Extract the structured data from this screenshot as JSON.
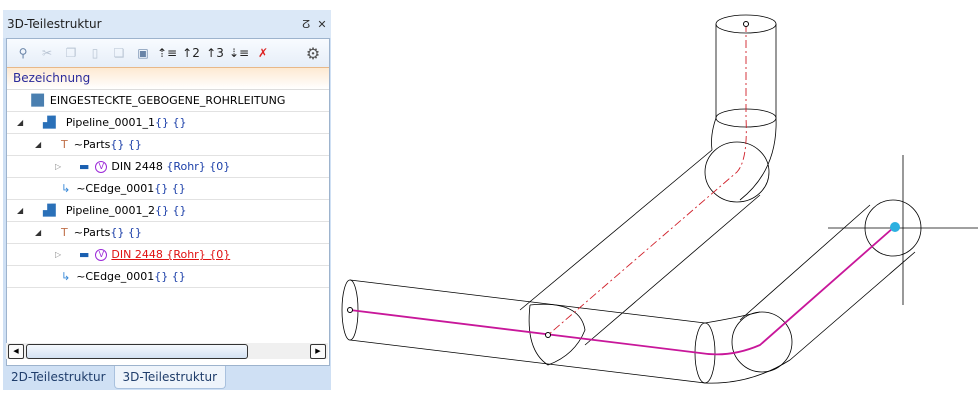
{
  "panel": {
    "title": "3D-Teilestruktur",
    "pin": "ⵒ",
    "close": "✕"
  },
  "toolbar": {
    "icons": [
      "find-icon",
      "cut-icon",
      "copy-icon",
      "paste-icon",
      "paste-special-icon",
      "paste-into-icon",
      "level-1-icon",
      "level-2-icon",
      "level-3-icon",
      "expand-all-icon",
      "sort-clear-icon",
      "settings-icon"
    ]
  },
  "header": {
    "column": "Bezeichnung"
  },
  "tree": [
    {
      "label": "EINGESTECKTE_GEBOGENE_ROHRLEITUNG",
      "suffix": ""
    },
    {
      "label": "Pipeline_0001_1",
      "suffix": " {} {}"
    },
    {
      "label": "~Parts",
      "suffix": " {} {}"
    },
    {
      "label": "DIN 2448",
      "suffix": " {Rohr} {0}"
    },
    {
      "label": "~CEdge_0001",
      "suffix": " {} {}"
    },
    {
      "label": "Pipeline_0001_2",
      "suffix": " {} {}"
    },
    {
      "label": "~Parts",
      "suffix": " {} {}"
    },
    {
      "label": "DIN 2448 {Rohr} {0}",
      "suffix": ""
    },
    {
      "label": "~CEdge_0001",
      "suffix": " {} {}"
    }
  ],
  "tabs": [
    {
      "label": "2D-Teilestruktur"
    },
    {
      "label": "3D-Teilestruktur"
    }
  ],
  "colors": {
    "path": "#c8179a",
    "axis": "#d0202a",
    "selected": "#e01010"
  }
}
